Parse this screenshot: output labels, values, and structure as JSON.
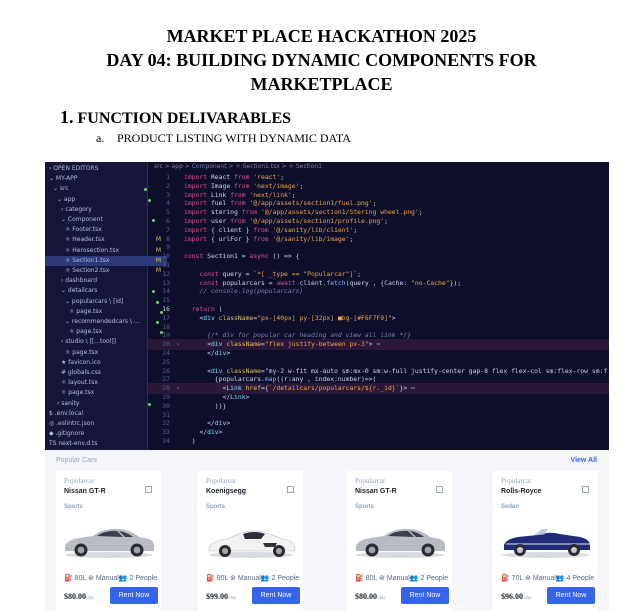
{
  "header": {
    "title_line1": "MARKET PLACE HACKATHON 2025",
    "title_line2": "DAY 04: BUILDING DYNAMIC COMPONENTS FOR",
    "title_line3": "MARKETPLACE"
  },
  "section": {
    "number": "1.",
    "title": "FUNCTION DELIVARABLES"
  },
  "subsection": {
    "letter": "a.",
    "title": "PRODUCT LISTING WITH DYNAMIC DATA"
  },
  "editor": {
    "breadcrumb": "src > app > Component > ⚛ Section1.tsx > ⚛ Section1",
    "explorer": [
      {
        "label": "› OPEN EDITORS",
        "indent": 4,
        "mark": ""
      },
      {
        "label": "⌄ MY-APP",
        "indent": 4,
        "mark": ""
      },
      {
        "label": "⌄ src",
        "indent": 8,
        "mark": "dot"
      },
      {
        "label": "⌄ app",
        "indent": 12,
        "mark": "dot"
      },
      {
        "label": "› category",
        "indent": 16,
        "mark": ""
      },
      {
        "label": "⌄ Component",
        "indent": 16,
        "mark": "dot"
      },
      {
        "label": "⚛ Footer.tsx",
        "indent": 20,
        "mark": ""
      },
      {
        "label": "⚛ Header.tsx",
        "indent": 20,
        "mark": "M"
      },
      {
        "label": "⚛ Herosection.tsx",
        "indent": 20,
        "mark": "M"
      },
      {
        "label": "⚛ Section1.tsx",
        "indent": 20,
        "mark": "M",
        "selected": true
      },
      {
        "label": "⚛ Section2.tsx",
        "indent": 20,
        "mark": "M"
      },
      {
        "label": "› dashboard",
        "indent": 16,
        "mark": ""
      },
      {
        "label": "⌄ detailcars",
        "indent": 16,
        "mark": "dot"
      },
      {
        "label": "⌄ popularcars \\ [id]",
        "indent": 20,
        "mark": "dot"
      },
      {
        "label": "⚛ page.tsx",
        "indent": 24,
        "mark": "dot"
      },
      {
        "label": "⌄ recommendedcars \\ …",
        "indent": 20,
        "mark": "dot"
      },
      {
        "label": "⚛ page.tsx",
        "indent": 24,
        "mark": "dot"
      },
      {
        "label": "› studio \\ [[...tool]]",
        "indent": 16,
        "mark": ""
      },
      {
        "label": "⚛ page.tsx",
        "indent": 20,
        "mark": ""
      },
      {
        "label": "★ favicon.ico",
        "indent": 16,
        "mark": ""
      },
      {
        "label": "# globals.css",
        "indent": 16,
        "mark": ""
      },
      {
        "label": "⚛ layout.tsx",
        "indent": 16,
        "mark": ""
      },
      {
        "label": "⚛ page.tsx",
        "indent": 16,
        "mark": ""
      },
      {
        "label": "› sanity",
        "indent": 12,
        "mark": "dot"
      },
      {
        "label": "$ .env.local",
        "indent": 4,
        "mark": ""
      },
      {
        "label": "◎ .eslintrc.json",
        "indent": 4,
        "mark": ""
      },
      {
        "label": "◆ .gitignore",
        "indent": 4,
        "mark": ""
      },
      {
        "label": "TS next-env.d.ts",
        "indent": 4,
        "mark": ""
      }
    ],
    "lines": [
      {
        "n": "1",
        "code": "import React from 'react';"
      },
      {
        "n": "2",
        "code": "import Image from 'next/image';"
      },
      {
        "n": "3",
        "code": "import Link from 'next/link';"
      },
      {
        "n": "4",
        "code": "import fuel from '@/app/assets/section1/fuel.png';"
      },
      {
        "n": "5",
        "code": "import stering from '@/app/assets/section1/Stering wheel.png';"
      },
      {
        "n": "6",
        "code": "import user from '@/app/assets/section1/profile.png';"
      },
      {
        "n": "7",
        "code": "import { client } from '@/sanity/lib/client';"
      },
      {
        "n": "8",
        "code": "import { urlFor } from '@/sanity/lib/image';"
      },
      {
        "n": "9",
        "code": ""
      },
      {
        "n": "10",
        "code": "const Section1 = async () => {"
      },
      {
        "n": "11",
        "code": ""
      },
      {
        "n": "12",
        "code": "    const query = `*[ _type == \"Popularcar\"]`;"
      },
      {
        "n": "13",
        "code": "    const popularcars = await client.fetch(query , {Cache: \"no-Cache\"});"
      },
      {
        "n": "14",
        "code": "    // console.log(popularcars)"
      },
      {
        "n": "15",
        "code": ""
      },
      {
        "n": "16",
        "code": "  return ("
      },
      {
        "n": "17",
        "code": "    <div className=\"px-[40px] py-[32px] ■bg-[#F6F7F9]\">"
      },
      {
        "n": "18",
        "code": ""
      },
      {
        "n": "19",
        "code": "      {/* div for popular car heading and view all link */}"
      },
      {
        "n": "20",
        "code": "      <div className=\"flex justify-between px-3\"> ⋯"
      },
      {
        "n": "24",
        "code": "      </div>"
      },
      {
        "n": "25",
        "code": ""
      },
      {
        "n": "26",
        "code": "      <div className=\"my-2 w-fit mx-auto sm:mx-0 sm:w-full justify-center gap-8 flex flex-col sm:flex-row sm:f"
      },
      {
        "n": "27",
        "code": "        {popularcars.map((r:any , index:number)=>("
      },
      {
        "n": "28",
        "code": "          <Link href={`/detailcars/popularcars/${r._id}`}> ⋯"
      },
      {
        "n": "29",
        "code": "          </Link>"
      },
      {
        "n": "30",
        "code": "        ))}"
      },
      {
        "n": "31",
        "code": ""
      },
      {
        "n": "32",
        "code": "      </div>"
      },
      {
        "n": "33",
        "code": "    </div>"
      },
      {
        "n": "34",
        "code": "  )"
      }
    ]
  },
  "shop": {
    "section_label": "Popular Cars",
    "view_all": "View All",
    "cards": [
      {
        "category": "Popularcar",
        "name": "Nissan GT-R",
        "type": "Sports",
        "fuel": "80L",
        "transmission": "Manual",
        "people": "2 People",
        "price": "$80.00",
        "per": "/day",
        "button": "Rent Now",
        "color": "#b9bcc2",
        "shape": "coupe"
      },
      {
        "category": "Popularcar",
        "name": "Koenigsegg",
        "type": "Sports",
        "fuel": "90L",
        "transmission": "Manual",
        "people": "2 People",
        "price": "$99.00",
        "per": "/day",
        "button": "Rent Now",
        "color": "#f2f2f2",
        "shape": "super"
      },
      {
        "category": "Popularcar",
        "name": "Nissan GT-R",
        "type": "Sports",
        "fuel": "80L",
        "transmission": "Manual",
        "people": "2 People",
        "price": "$80.00",
        "per": "/day",
        "button": "Rent Now",
        "color": "#b9bcc2",
        "shape": "coupe"
      },
      {
        "category": "Popularcar",
        "name": "Rolls-Royce",
        "type": "Sedan",
        "fuel": "70L",
        "transmission": "Manual",
        "people": "4 People",
        "price": "$96.00",
        "per": "/day",
        "button": "Rent Now",
        "color": "#1f2a78",
        "shape": "convertible"
      }
    ]
  }
}
